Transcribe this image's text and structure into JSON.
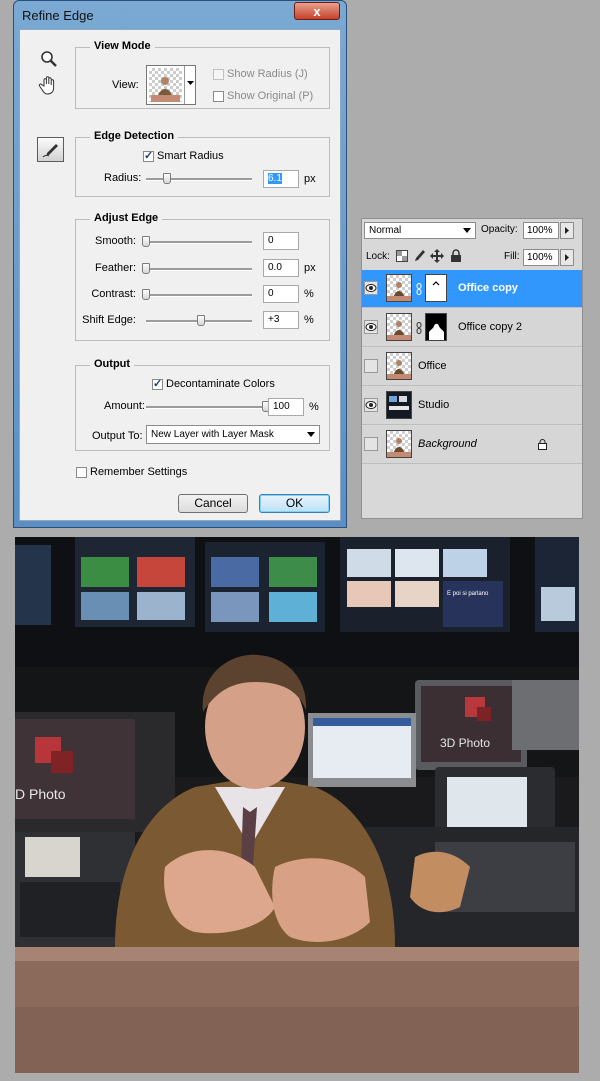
{
  "dialog": {
    "title": "Refine Edge",
    "close_label": "x",
    "view_mode": {
      "title": "View Mode",
      "view_label": "View:",
      "show_radius": "Show Radius (J)",
      "show_original": "Show Original (P)"
    },
    "edge_detection": {
      "title": "Edge Detection",
      "smart_radius": "Smart Radius",
      "radius_label": "Radius:",
      "radius_value": "6.1",
      "radius_unit": "px",
      "radius_level": 0.2
    },
    "adjust_edge": {
      "title": "Adjust Edge",
      "rows": [
        {
          "label": "Smooth:",
          "value": "0",
          "unit": "",
          "level": 0.0
        },
        {
          "label": "Feather:",
          "value": "0.0",
          "unit": "px",
          "level": 0.0
        },
        {
          "label": "Contrast:",
          "value": "0",
          "unit": "%",
          "level": 0.0
        },
        {
          "label": "Shift Edge:",
          "value": "+3",
          "unit": "%",
          "level": 0.52
        }
      ]
    },
    "output": {
      "title": "Output",
      "decontaminate": "Decontaminate Colors",
      "amount_label": "Amount:",
      "amount_value": "100",
      "amount_unit": "%",
      "amount_level": 1.0,
      "output_to_label": "Output To:",
      "output_to_value": "New Layer with Layer Mask"
    },
    "remember": "Remember Settings",
    "cancel": "Cancel",
    "ok": "OK"
  },
  "layers": {
    "blend_mode": "Normal",
    "opacity_label": "Opacity:",
    "opacity_value": "100%",
    "lock_label": "Lock:",
    "fill_label": "Fill:",
    "fill_value": "100%",
    "items": [
      {
        "name": "Office copy",
        "visible": true,
        "selected": true
      },
      {
        "name": "Office copy 2",
        "visible": true,
        "selected": false
      },
      {
        "name": "Office",
        "visible": false,
        "selected": false
      },
      {
        "name": "Studio",
        "visible": true,
        "selected": false
      },
      {
        "name": "Background",
        "visible": false,
        "selected": false
      }
    ]
  },
  "photo": {
    "logo_left": "D Photo",
    "logo_right": "3D Photo",
    "screen_text": "E poi si parlano della sera in iniziata la sera con l'articipo tra Parma e Rimini"
  },
  "colors": {
    "selection": "#3297fd",
    "title_bar": "#6b9dcc",
    "close_button": "#c9472f"
  }
}
